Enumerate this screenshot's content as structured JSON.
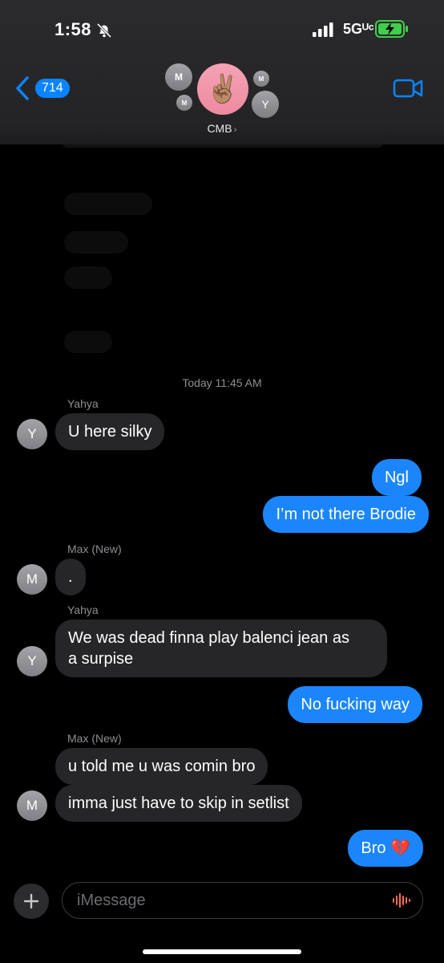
{
  "status_bar": {
    "time": "1:58",
    "network": "5Gᵁᶜ"
  },
  "header": {
    "back_count": "714",
    "group_name": "CMB",
    "group_emoji": "✌🏽",
    "participants": [
      "M",
      "M",
      "M",
      "Y"
    ]
  },
  "conversation": {
    "timestamp": "Today 11:45 AM",
    "senders": {
      "yahya": "Yahya",
      "max": "Max (New)"
    },
    "messages": [
      {
        "text": "U here silky"
      },
      {
        "text": "Ngl"
      },
      {
        "text": "I’m not there Brodie"
      },
      {
        "text": "."
      },
      {
        "text": "We was dead finna play balenci jean as\na surpise"
      },
      {
        "text": "No fucking way"
      },
      {
        "text": "u told me u was comin bro"
      },
      {
        "text": "imma just have to skip in setlist"
      },
      {
        "text": "Bro 💔"
      }
    ],
    "avatars": {
      "y": "Y",
      "m": "M"
    }
  },
  "composer": {
    "placeholder": "iMessage"
  }
}
